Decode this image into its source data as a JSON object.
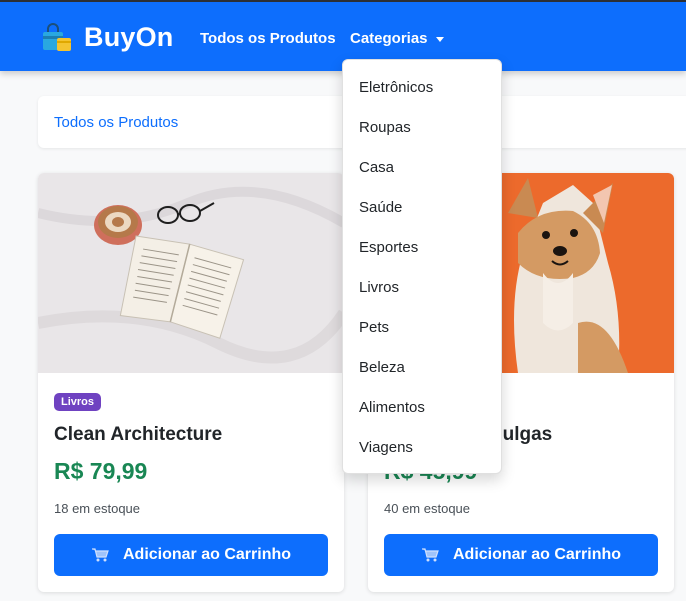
{
  "navbar": {
    "brand": "BuyOn",
    "links": {
      "all_products": "Todos os Produtos",
      "categories": "Categorias"
    }
  },
  "breadcrumb": {
    "label": "Todos os Produtos"
  },
  "dropdown": {
    "items": [
      "Eletrônicos",
      "Roupas",
      "Casa",
      "Saúde",
      "Esportes",
      "Livros",
      "Pets",
      "Beleza",
      "Alimentos",
      "Viagens"
    ]
  },
  "products": [
    {
      "badge": "Livros",
      "title": "Clean Architecture",
      "price": "R$ 79,99",
      "stock": "18 em estoque",
      "button": "Adicionar ao Carrinho"
    },
    {
      "title_fragment": "pulgas",
      "price_fragment": "R$ 45,99",
      "stock": "40 em estoque",
      "button": "Adicionar ao Carrinho"
    }
  ],
  "colors": {
    "primary": "#0d6efd",
    "price_green": "#198754",
    "badge_purple": "#6f42c1",
    "page_bg": "#f8f9fa"
  },
  "icons": {
    "brand": "shopping-bag-icon",
    "cart": "cart-icon",
    "dropdown_caret": "chevron-down-icon"
  }
}
